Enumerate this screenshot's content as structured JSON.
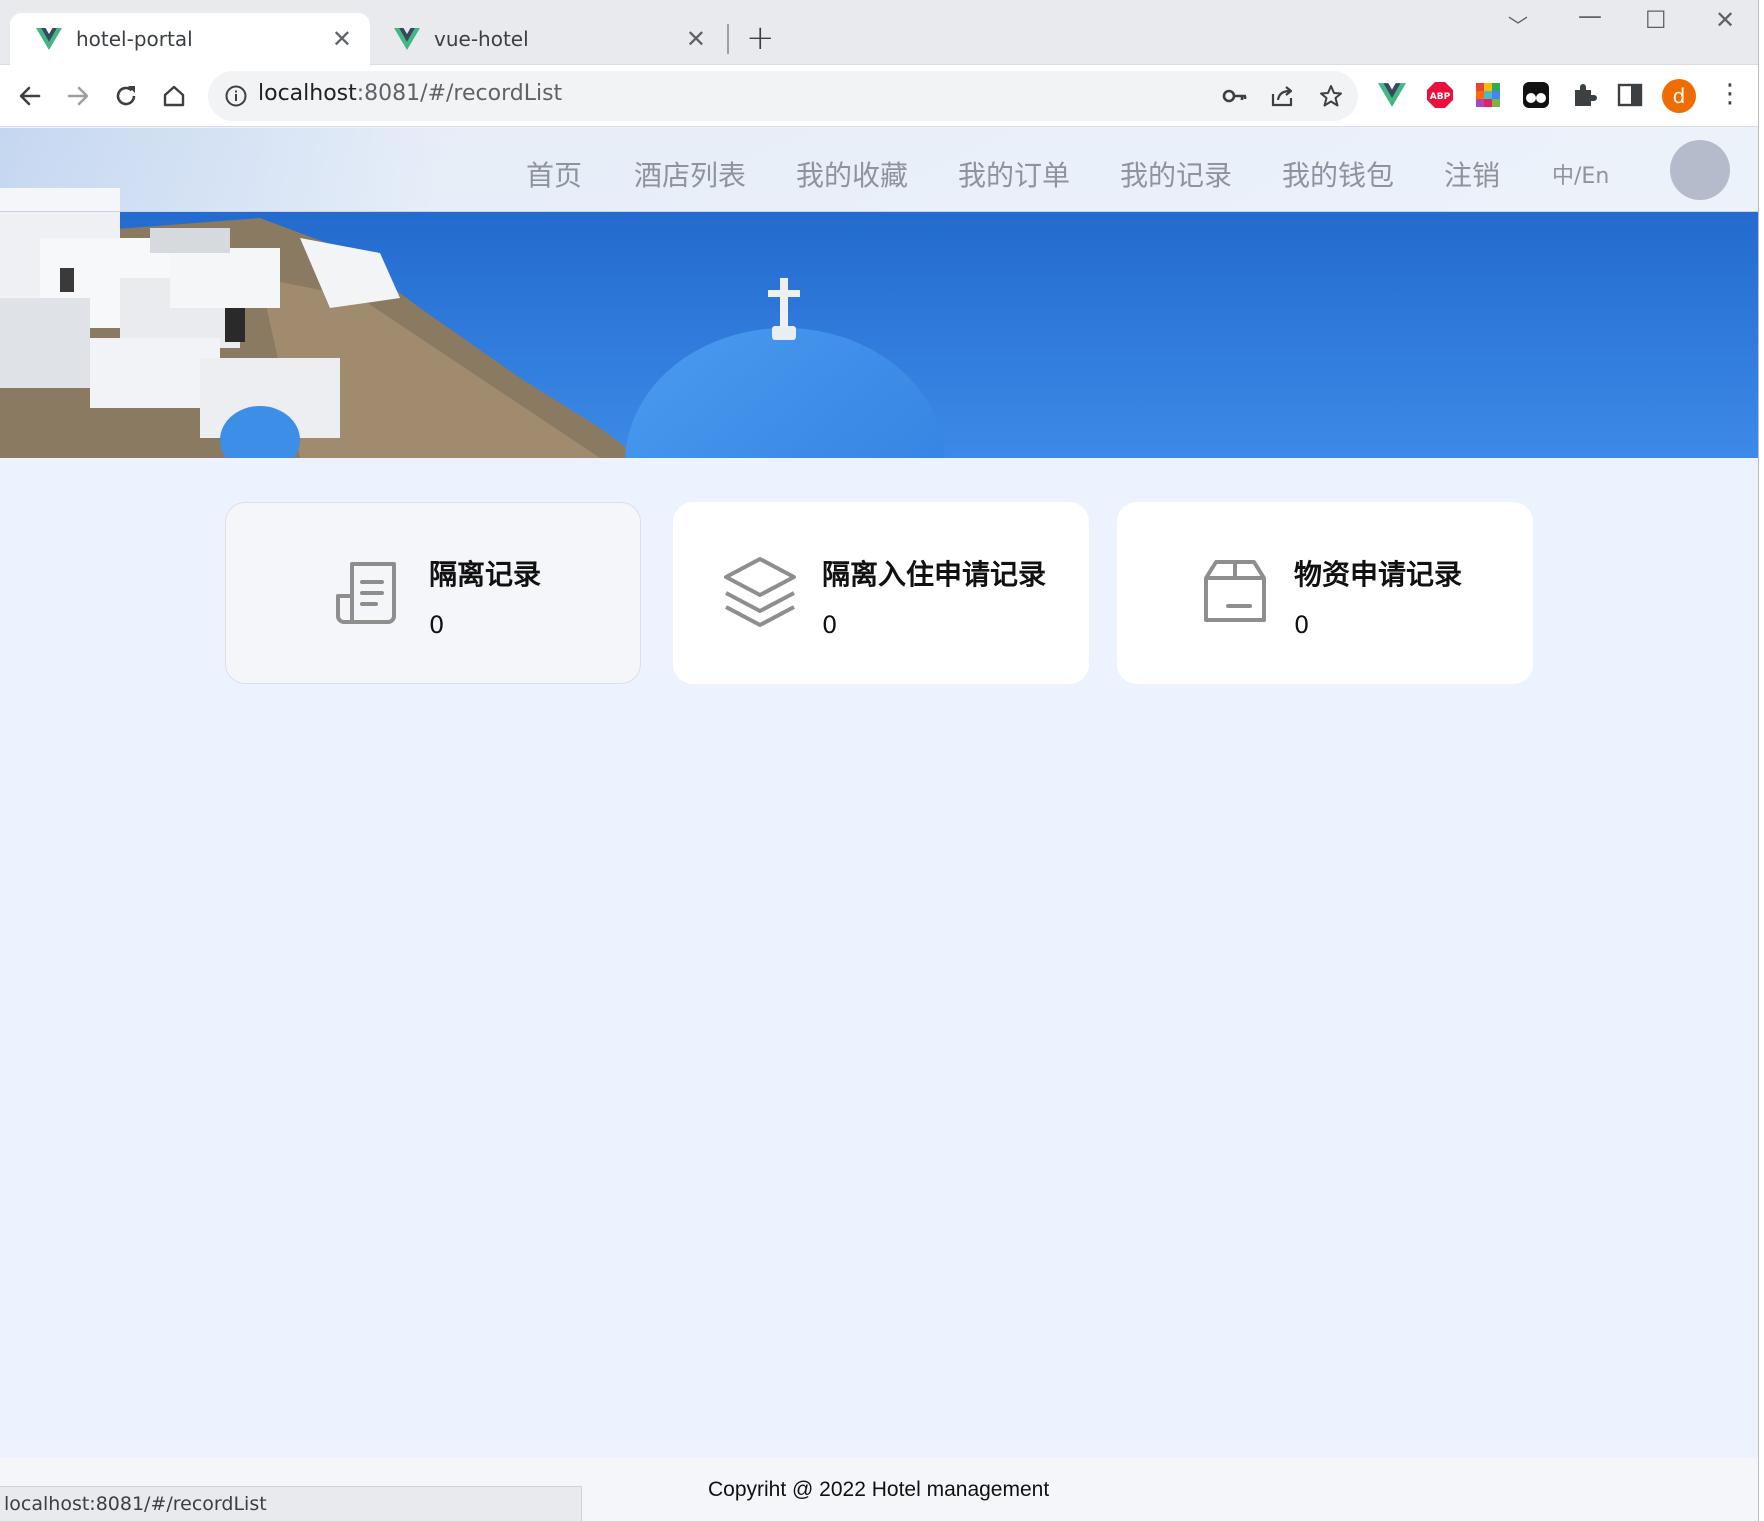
{
  "browser": {
    "tabs": [
      {
        "title": "hotel-portal",
        "icon": "vue-icon",
        "active": true
      },
      {
        "title": "vue-hotel",
        "icon": "vue-icon",
        "active": false
      }
    ],
    "new_tab_label": "+",
    "url_host": "localhost",
    "url_rest": ":8081/#/recordList",
    "profile_initial": "d",
    "status_url": "localhost:8081/#/recordList"
  },
  "site_nav": {
    "items": [
      "首页",
      "酒店列表",
      "我的收藏",
      "我的订单",
      "我的记录",
      "我的钱包",
      "注销"
    ],
    "lang": "中/En"
  },
  "cards": [
    {
      "title": "隔离记录",
      "value": "0",
      "icon": "document-icon"
    },
    {
      "title": "隔离入住申请记录",
      "value": "0",
      "icon": "layers-icon"
    },
    {
      "title": "物资申请记录",
      "value": "0",
      "icon": "box-icon"
    }
  ],
  "footer": {
    "copyright": "Copyriht @ 2022 Hotel management"
  },
  "colors": {
    "page_bg": "#edf3fe",
    "nav_text": "#909399",
    "card_bg": "#ffffff",
    "avatar": "#b4bccc"
  }
}
